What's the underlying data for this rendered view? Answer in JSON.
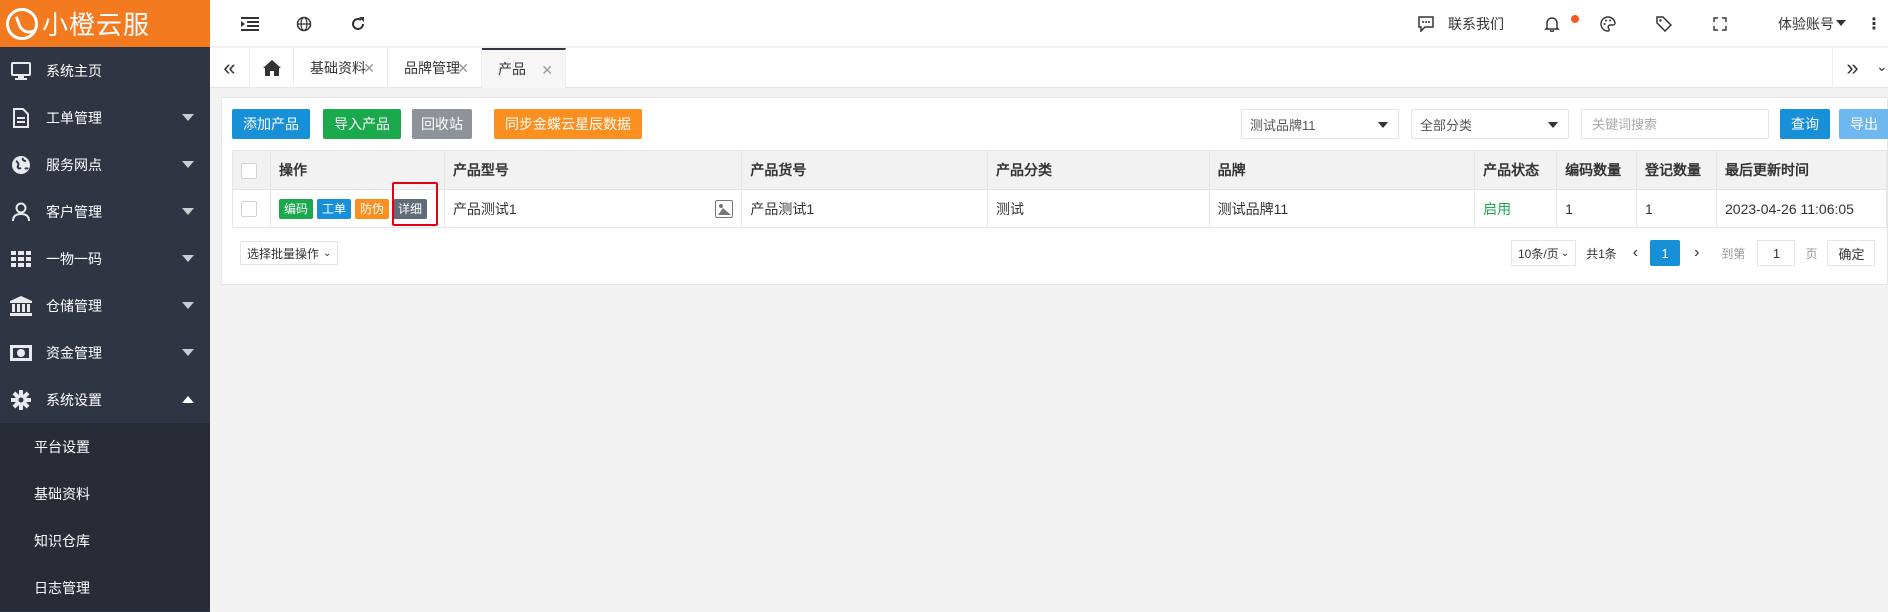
{
  "brand": {
    "name": "小橙云服",
    "color": "#f47a20"
  },
  "sidebar": {
    "items": [
      {
        "label": "系统主页",
        "icon": "monitor-icon"
      },
      {
        "label": "工单管理",
        "icon": "document-icon"
      },
      {
        "label": "服务网点",
        "icon": "globe-icon"
      },
      {
        "label": "客户管理",
        "icon": "user-icon"
      },
      {
        "label": "一物一码",
        "icon": "grid-icon"
      },
      {
        "label": "仓储管理",
        "icon": "bank-icon"
      },
      {
        "label": "资金管理",
        "icon": "money-icon"
      },
      {
        "label": "系统设置",
        "icon": "gear-icon"
      }
    ],
    "subitems": [
      "平台设置",
      "基础资料",
      "知识仓库",
      "日志管理"
    ]
  },
  "topbar": {
    "contact": "联系我们",
    "account": "体验账号"
  },
  "tabs": [
    {
      "label": "基础资料"
    },
    {
      "label": "品牌管理"
    },
    {
      "label": "产品"
    }
  ],
  "toolbar": {
    "add": "添加产品",
    "import": "导入产品",
    "recycle": "回收站",
    "sync": "同步金蝶云星辰数据",
    "brand_select": "测试品牌11",
    "category_select": "全部分类",
    "search_placeholder": "关键词搜索",
    "query": "查询",
    "export": "导出"
  },
  "table": {
    "headers": [
      "操作",
      "产品型号",
      "产品货号",
      "产品分类",
      "品牌",
      "产品状态",
      "编码数量",
      "登记数量",
      "最后更新时间"
    ],
    "row_actions": [
      "编码",
      "工单",
      "防伪",
      "详细"
    ],
    "rows": [
      {
        "model": "产品测试1",
        "sku": "产品测试1",
        "category": "测试",
        "brand": "测试品牌11",
        "status": "启用",
        "code_count": "1",
        "reg_count": "1",
        "updated": "2023-04-26 11:06:05"
      }
    ]
  },
  "footer": {
    "batch": "选择批量操作",
    "page_size": "10条/页",
    "total": "共1条",
    "current_page": "1",
    "goto_label": "到第",
    "goto_value": "1",
    "page_unit": "页",
    "confirm": "确定"
  }
}
